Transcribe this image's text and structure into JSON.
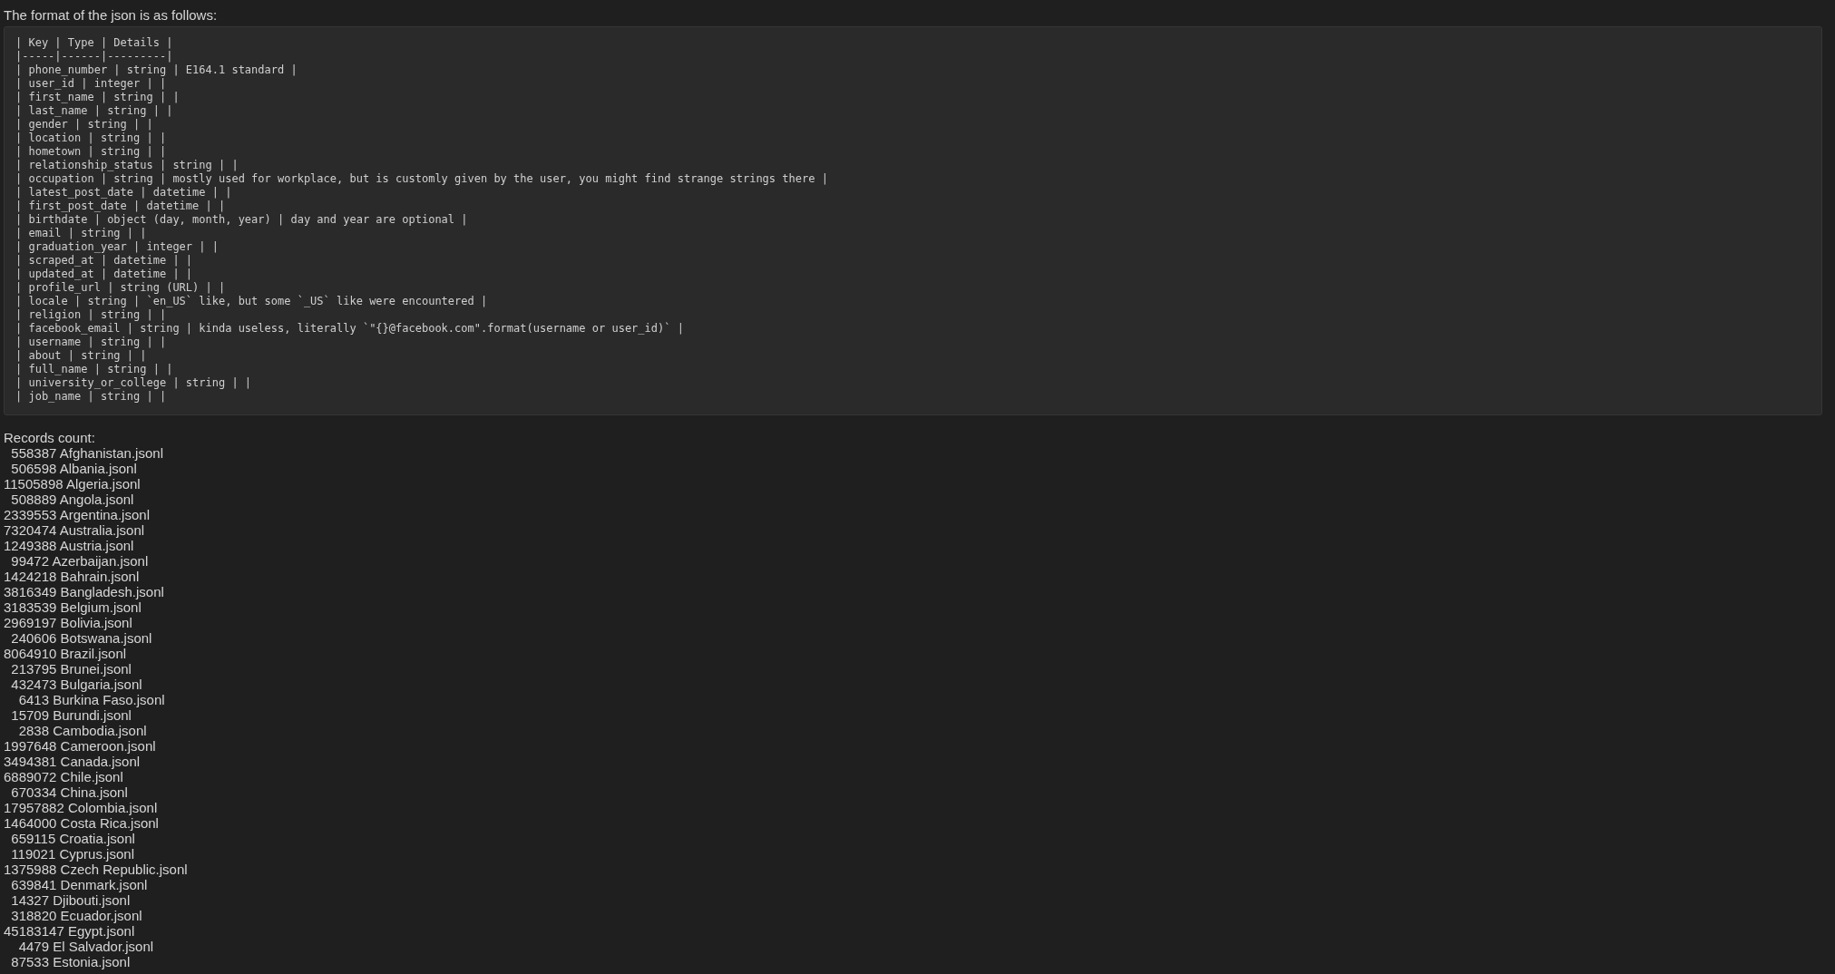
{
  "intro": "The format of the json is as follows:",
  "code_lines": [
    "| Key | Type | Details |",
    "|-----|------|---------|",
    "| phone_number | string | E164.1 standard |",
    "| user_id | integer | |",
    "| first_name | string | |",
    "| last_name | string | |",
    "| gender | string | |",
    "| location | string | |",
    "| hometown | string | |",
    "| relationship_status | string | |",
    "| occupation | string | mostly used for workplace, but is customly given by the user, you might find strange strings there |",
    "| latest_post_date | datetime | |",
    "| first_post_date | datetime | |",
    "| birthdate | object (day, month, year) | day and year are optional |",
    "| email | string | |",
    "| graduation_year | integer | |",
    "| scraped_at | datetime | |",
    "| updated_at | datetime | |",
    "| profile_url | string (URL) | |",
    "| locale | string | `en_US` like, but some `_US` like were encountered |",
    "| religion | string | |",
    "| facebook_email | string | kinda useless, literally `\"{}@facebook.com\".format(username or user_id)` |",
    "| username | string | |",
    "| about | string | |",
    "| full_name | string | |",
    "| university_or_college | string | |",
    "| job_name | string | |"
  ],
  "records_label": "Records count:",
  "records": [
    "  558387 Afghanistan.jsonl",
    "  506598 Albania.jsonl",
    "11505898 Algeria.jsonl",
    "  508889 Angola.jsonl",
    "2339553 Argentina.jsonl",
    "7320474 Australia.jsonl",
    "1249388 Austria.jsonl",
    "  99472 Azerbaijan.jsonl",
    "1424218 Bahrain.jsonl",
    "3816349 Bangladesh.jsonl",
    "3183539 Belgium.jsonl",
    "2969197 Bolivia.jsonl",
    "  240606 Botswana.jsonl",
    "8064910 Brazil.jsonl",
    "  213795 Brunei.jsonl",
    "  432473 Bulgaria.jsonl",
    "    6413 Burkina Faso.jsonl",
    "  15709 Burundi.jsonl",
    "    2838 Cambodia.jsonl",
    "1997648 Cameroon.jsonl",
    "3494381 Canada.jsonl",
    "6889072 Chile.jsonl",
    "  670334 China.jsonl",
    "17957882 Colombia.jsonl",
    "1464000 Costa Rica.jsonl",
    "  659115 Croatia.jsonl",
    "  119021 Cyprus.jsonl",
    "1375988 Czech Republic.jsonl",
    "  639841 Denmark.jsonl",
    "  14327 Djibouti.jsonl",
    "  318820 Ecuador.jsonl",
    "45183147 Egypt.jsonl",
    "    4479 El Salvador.jsonl",
    "  87533 Estonia.jsonl"
  ]
}
